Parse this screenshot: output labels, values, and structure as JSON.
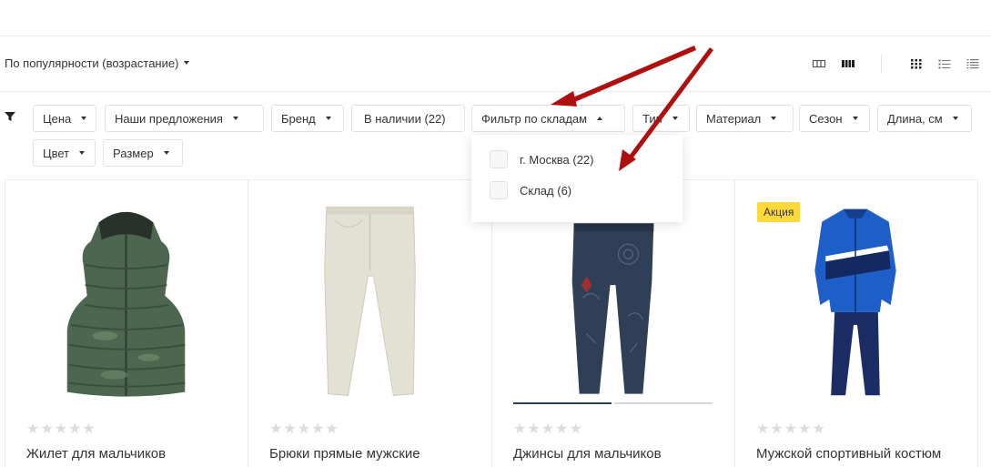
{
  "sort": {
    "label": "По популярности (возрастание)"
  },
  "view_icons": [
    "columns-view-icon",
    "rows-view-icon",
    "grid-view-icon",
    "list-view-icon",
    "compact-list-view-icon"
  ],
  "filters": {
    "chips": [
      "Цена",
      "Наши предложения",
      "Бренд",
      "В наличии (22)",
      "Фильтр по складам",
      "Тип",
      "Материал",
      "Сезон",
      "Длина, см",
      "Цвет",
      "Размер"
    ],
    "warehouse_dropdown": {
      "options": [
        "г. Москва (22)",
        "Склад (6)"
      ]
    }
  },
  "products": [
    {
      "title": "Жилет для мальчиков",
      "rating": 0,
      "badge": ""
    },
    {
      "title": "Брюки прямые мужские",
      "rating": 0,
      "badge": ""
    },
    {
      "title": "Джинсы для мальчиков",
      "rating": 0,
      "badge": ""
    },
    {
      "title": "Мужской спортивный костюм",
      "rating": 0,
      "badge": "Акция"
    }
  ],
  "stars": "★★★★★",
  "colors": {
    "accent_green": "#4caf50",
    "badge_yellow": "#ffd83a",
    "arrow_red": "#b00f0f"
  }
}
